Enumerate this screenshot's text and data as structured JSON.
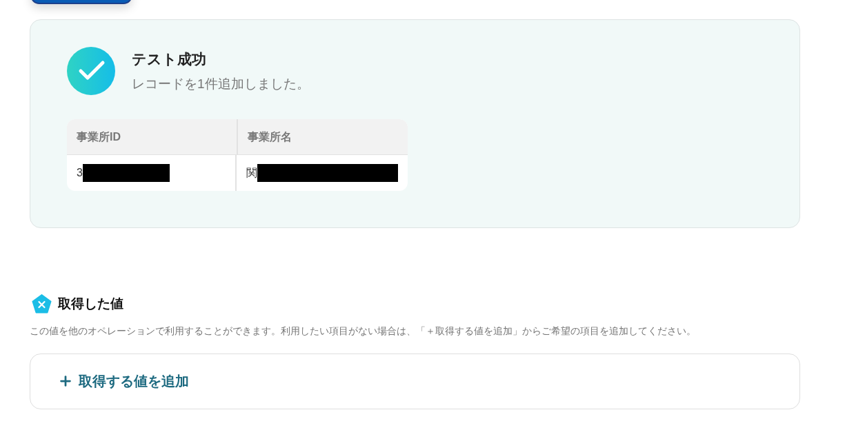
{
  "result": {
    "title": "テスト成功",
    "message": "レコードを1件追加しました。",
    "table": {
      "columns": [
        "事業所ID",
        "事業所名"
      ],
      "rows": [
        [
          "3",
          "関"
        ]
      ]
    }
  },
  "values_section": {
    "title": "取得した値",
    "description": "この値を他のオペレーションで利用することができます。利用したい項目がない場合は、「＋取得する値を追加」からご希望の項目を追加してください。",
    "add_button": "取得する値を追加"
  }
}
